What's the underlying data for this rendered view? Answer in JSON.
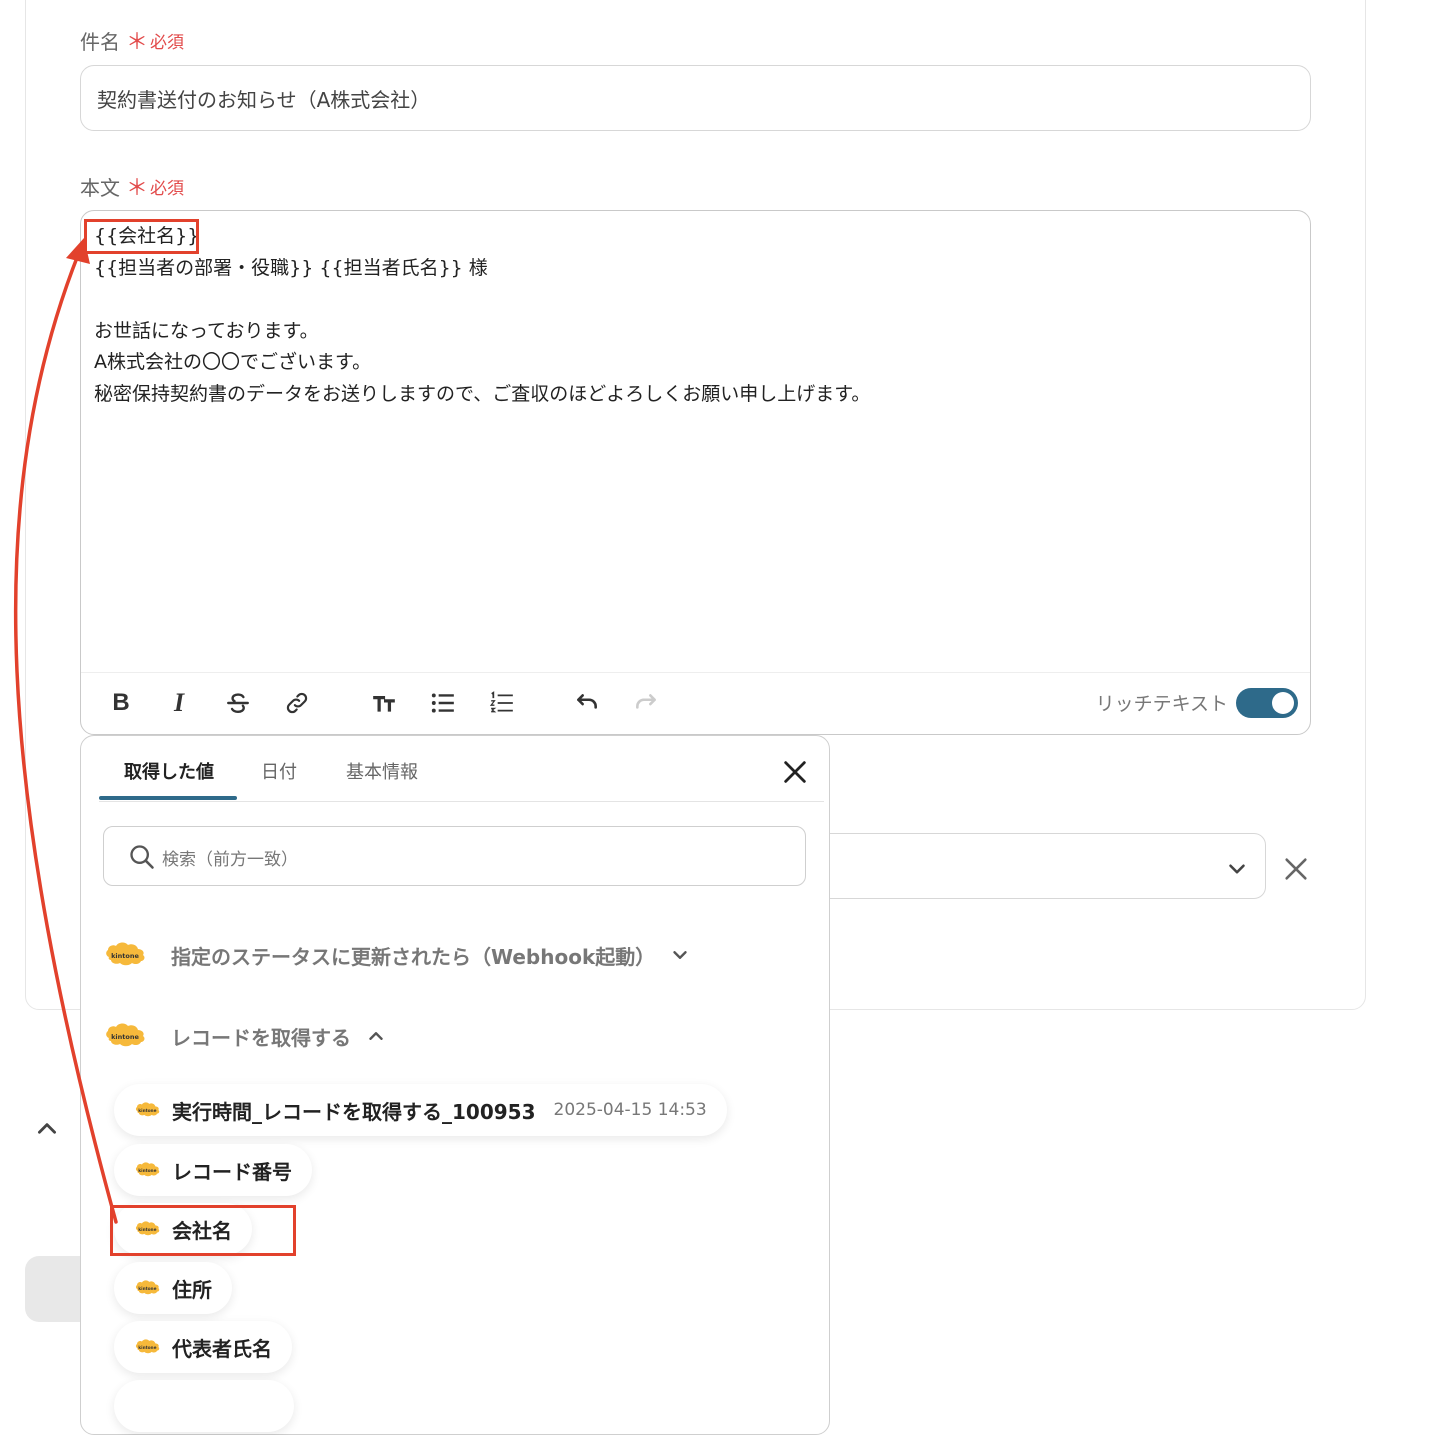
{
  "subject": {
    "label": "件名",
    "required_mark": "＊",
    "required_text": "必須",
    "value": "契約書送付のお知らせ（A株式会社）"
  },
  "body": {
    "label": "本文",
    "required_mark": "＊",
    "required_text": "必須",
    "lines": [
      "{{会社名}}",
      "{{担当者の部署・役職}} {{担当者氏名}} 様",
      "",
      "お世話になっております。",
      "A株式会社の〇〇でございます。",
      "秘密保持契約書のデータをお送りしますので、ご査収のほどよろしくお願い申し上げます。"
    ]
  },
  "toolbar": {
    "bold": "B",
    "italic": "I",
    "rich_text_label": "リッチテキスト",
    "rich_text_on": true
  },
  "panel": {
    "tabs": [
      "取得した値",
      "日付",
      "基本情報"
    ],
    "active_tab": 0,
    "search_placeholder": "検索（前方一致）",
    "groups": [
      {
        "title": "指定のステータスに更新されたら（Webhook起動）",
        "expanded": false,
        "logo": "kintone"
      },
      {
        "title": "レコードを取得する",
        "expanded": true,
        "logo": "kintone"
      }
    ],
    "items": [
      {
        "name": "実行時間_レコードを取得する_100953",
        "value": "2025-04-15 14:53"
      },
      {
        "name": "レコード番号",
        "value": ""
      },
      {
        "name": "会社名",
        "value": ""
      },
      {
        "name": "住所",
        "value": ""
      },
      {
        "name": "代表者氏名",
        "value": ""
      }
    ]
  },
  "colors": {
    "accent": "#2e6a8a",
    "required": "#e24b4b",
    "highlight": "#e2412c",
    "kintone": "#f6b93b"
  }
}
